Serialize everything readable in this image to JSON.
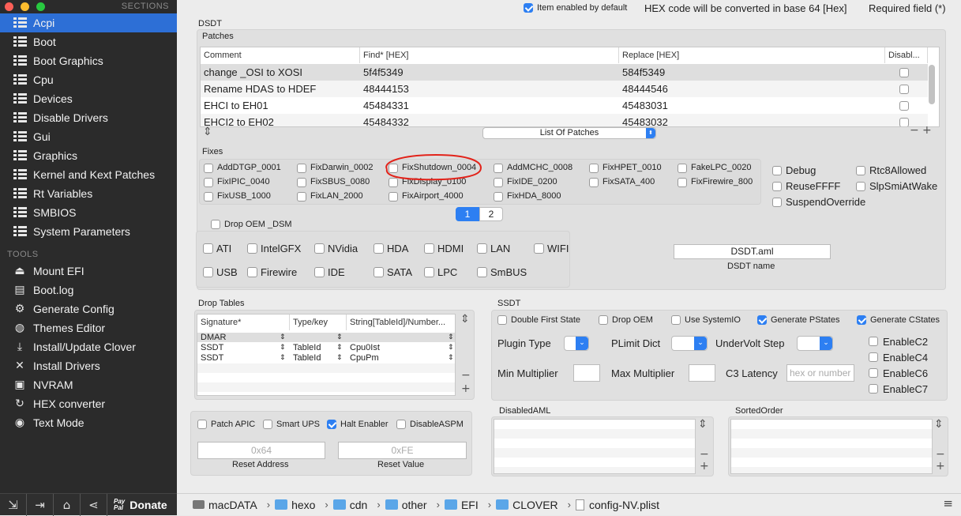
{
  "sidebar": {
    "sections_label": "SECTIONS",
    "tools_label": "TOOLS",
    "sections": [
      "Acpi",
      "Boot",
      "Boot Graphics",
      "Cpu",
      "Devices",
      "Disable Drivers",
      "Gui",
      "Graphics",
      "Kernel and Kext Patches",
      "Rt Variables",
      "SMBIOS",
      "System Parameters"
    ],
    "tools": [
      {
        "label": "Mount EFI",
        "icon": "mount-efi-icon"
      },
      {
        "label": "Boot.log",
        "icon": "document-icon"
      },
      {
        "label": "Generate Config",
        "icon": "gear-icon"
      },
      {
        "label": "Themes Editor",
        "icon": "palette-icon"
      },
      {
        "label": "Install/Update Clover",
        "icon": "install-icon"
      },
      {
        "label": "Install Drivers",
        "icon": "tools-icon"
      },
      {
        "label": "NVRAM",
        "icon": "chip-icon"
      },
      {
        "label": "HEX converter",
        "icon": "refresh-icon"
      },
      {
        "label": "Text Mode",
        "icon": "eye-icon"
      }
    ],
    "bottom": {
      "paypal": "Pay\nPal",
      "donate": "Donate"
    }
  },
  "topbar": {
    "item_enabled": "Item enabled by default",
    "hex_note": "HEX code will be converted in base 64 [Hex]",
    "required": "Required field (*)"
  },
  "dsdt": {
    "title": "DSDT",
    "patches_label": "Patches",
    "columns": [
      "Comment",
      "Find* [HEX]",
      "Replace [HEX]",
      "Disabl..."
    ],
    "rows": [
      {
        "comment": "change _OSI to XOSI",
        "find": "5f4f5349",
        "replace": "584f5349"
      },
      {
        "comment": "Rename HDAS to HDEF",
        "find": "48444153",
        "replace": "48444546"
      },
      {
        "comment": "EHCI to EH01",
        "find": "45484331",
        "replace": "45483031"
      },
      {
        "comment": "EHCI2 to EH02",
        "find": "45484332",
        "replace": "45483032"
      }
    ],
    "list_popup": "List Of Patches",
    "fixes_label": "Fixes",
    "fixes": [
      [
        "AddDTGP_0001",
        "FixDarwin_0002",
        "FixShutdown_0004",
        "AddMCHC_0008",
        "FixHPET_0010",
        "FakeLPC_0020"
      ],
      [
        "FixIPIC_0040",
        "FixSBUS_0080",
        "FixDisplay_0100",
        "FixIDE_0200",
        "FixSATA_400",
        "FixFirewire_800"
      ],
      [
        "FixUSB_1000",
        "FixLAN_2000",
        "FixAirport_4000",
        "FixHDA_8000"
      ]
    ],
    "extra_fixes": [
      "Debug",
      "Rtc8Allowed",
      "ReuseFFFF",
      "SlpSmiAtWake",
      "SuspendOverride"
    ],
    "pages": [
      "1",
      "2"
    ],
    "drop_oem_dsm": "Drop OEM _DSM",
    "dsm_row1": [
      "ATI",
      "IntelGFX",
      "NVidia",
      "HDA",
      "HDMI",
      "LAN",
      "WIFI"
    ],
    "dsm_row2": [
      "USB",
      "Firewire",
      "IDE",
      "SATA",
      "LPC",
      "SmBUS"
    ],
    "dsdt_name_value": "DSDT.aml",
    "dsdt_name_label": "DSDT name"
  },
  "drop_tables": {
    "title": "Drop Tables",
    "columns": [
      "Signature*",
      "Type/key",
      "String[TableId]/Number..."
    ],
    "rows": [
      {
        "sig": "DMAR",
        "type": "",
        "str": ""
      },
      {
        "sig": "SSDT",
        "type": "TableId",
        "str": "Cpu0Ist"
      },
      {
        "sig": "SSDT",
        "type": "TableId",
        "str": "CpuPm"
      }
    ]
  },
  "misc": {
    "patch_apic": "Patch APIC",
    "smart_ups": "Smart UPS",
    "halt_enabler": "Halt Enabler",
    "disable_aspm": "DisableASPM",
    "reset_address_value": "0x64",
    "reset_address_label": "Reset Address",
    "reset_value_value": "0xFE",
    "reset_value_label": "Reset Value"
  },
  "ssdt": {
    "title": "SSDT",
    "options": [
      "Double First State",
      "Drop OEM",
      "Use SystemIO",
      "Generate PStates",
      "Generate CStates"
    ],
    "plugin_type": "Plugin Type",
    "plimit_dict": "PLimit Dict",
    "undervolt_step": "UnderVolt Step",
    "min_multiplier": "Min Multiplier",
    "max_multiplier": "Max Multiplier",
    "c3_latency": "C3 Latency",
    "c3_placeholder": "hex or number",
    "enable_c": [
      "EnableC2",
      "EnableC4",
      "EnableC6",
      "EnableC7"
    ]
  },
  "disabled_aml": "DisabledAML",
  "sorted_order": "SortedOrder",
  "pathbar": [
    "macDATA",
    "hexo",
    "cdn",
    "other",
    "EFI",
    "CLOVER",
    "config-NV.plist"
  ]
}
